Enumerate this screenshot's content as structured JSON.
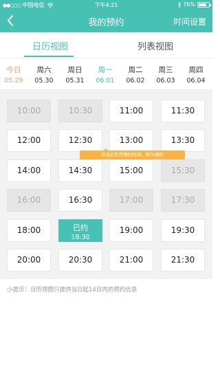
{
  "status_bar": {
    "signal_dots": "●●○○○",
    "carrier": "中国电信",
    "wifi_icon": "wifi-icon",
    "time": "下午4:21",
    "bluetooth": "∦",
    "battery_percent": "76%",
    "battery_level": 0.76
  },
  "navbar": {
    "title": "我的预约",
    "right_button": "时间设置",
    "back_icon": "chevron-left-icon"
  },
  "tabs": [
    {
      "label": "日历视图",
      "active": true
    },
    {
      "label": "列表视图",
      "active": false
    }
  ],
  "days": [
    {
      "weekday": "今日",
      "date": "05.29",
      "state": "today"
    },
    {
      "weekday": "周六",
      "date": "05.30",
      "state": ""
    },
    {
      "weekday": "周日",
      "date": "05.31",
      "state": ""
    },
    {
      "weekday": "周一",
      "date": "06.01",
      "state": "selected"
    },
    {
      "weekday": "周二",
      "date": "06.02",
      "state": ""
    },
    {
      "weekday": "周三",
      "date": "06.03",
      "state": ""
    },
    {
      "weekday": "周四",
      "date": "06.04",
      "state": ""
    }
  ],
  "slots": [
    {
      "time": "10:00",
      "state": "disabled"
    },
    {
      "time": "10:30",
      "state": "disabled"
    },
    {
      "time": "11:00",
      "state": "available"
    },
    {
      "time": "11:30",
      "state": "available"
    },
    {
      "time": "12:00",
      "state": "available"
    },
    {
      "time": "12:30",
      "state": "available"
    },
    {
      "time": "13:00",
      "state": "available"
    },
    {
      "time": "13:30",
      "state": "available"
    },
    {
      "time": "14:00",
      "state": "available"
    },
    {
      "time": "14:30",
      "state": "available"
    },
    {
      "time": "15:00",
      "state": "available"
    },
    {
      "time": "15:30",
      "state": "disabled"
    },
    {
      "time": "16:00",
      "state": "disabled"
    },
    {
      "time": "16:30",
      "state": "available"
    },
    {
      "time": "17:00",
      "state": "disabled"
    },
    {
      "time": "17:30",
      "state": "disabled"
    },
    {
      "time": "18:00",
      "state": "available"
    },
    {
      "time": "18:30",
      "state": "booked",
      "booked_label": "已约"
    },
    {
      "time": "19:00",
      "state": "available"
    },
    {
      "time": "19:30",
      "state": "available"
    },
    {
      "time": "20:00",
      "state": "available"
    },
    {
      "time": "20:30",
      "state": "available"
    },
    {
      "time": "21:00",
      "state": "available"
    },
    {
      "time": "21:30",
      "state": "available"
    }
  ],
  "tooltip": "点击白色可预约时间，帮Ta预约",
  "tip": "小提示：日历视图只提供当日起14日内的预约信息",
  "colors": {
    "accent": "#47c1b4",
    "today": "#f39c73",
    "tooltip": "#f5b445",
    "disabled_bg": "#e6e6e6"
  }
}
